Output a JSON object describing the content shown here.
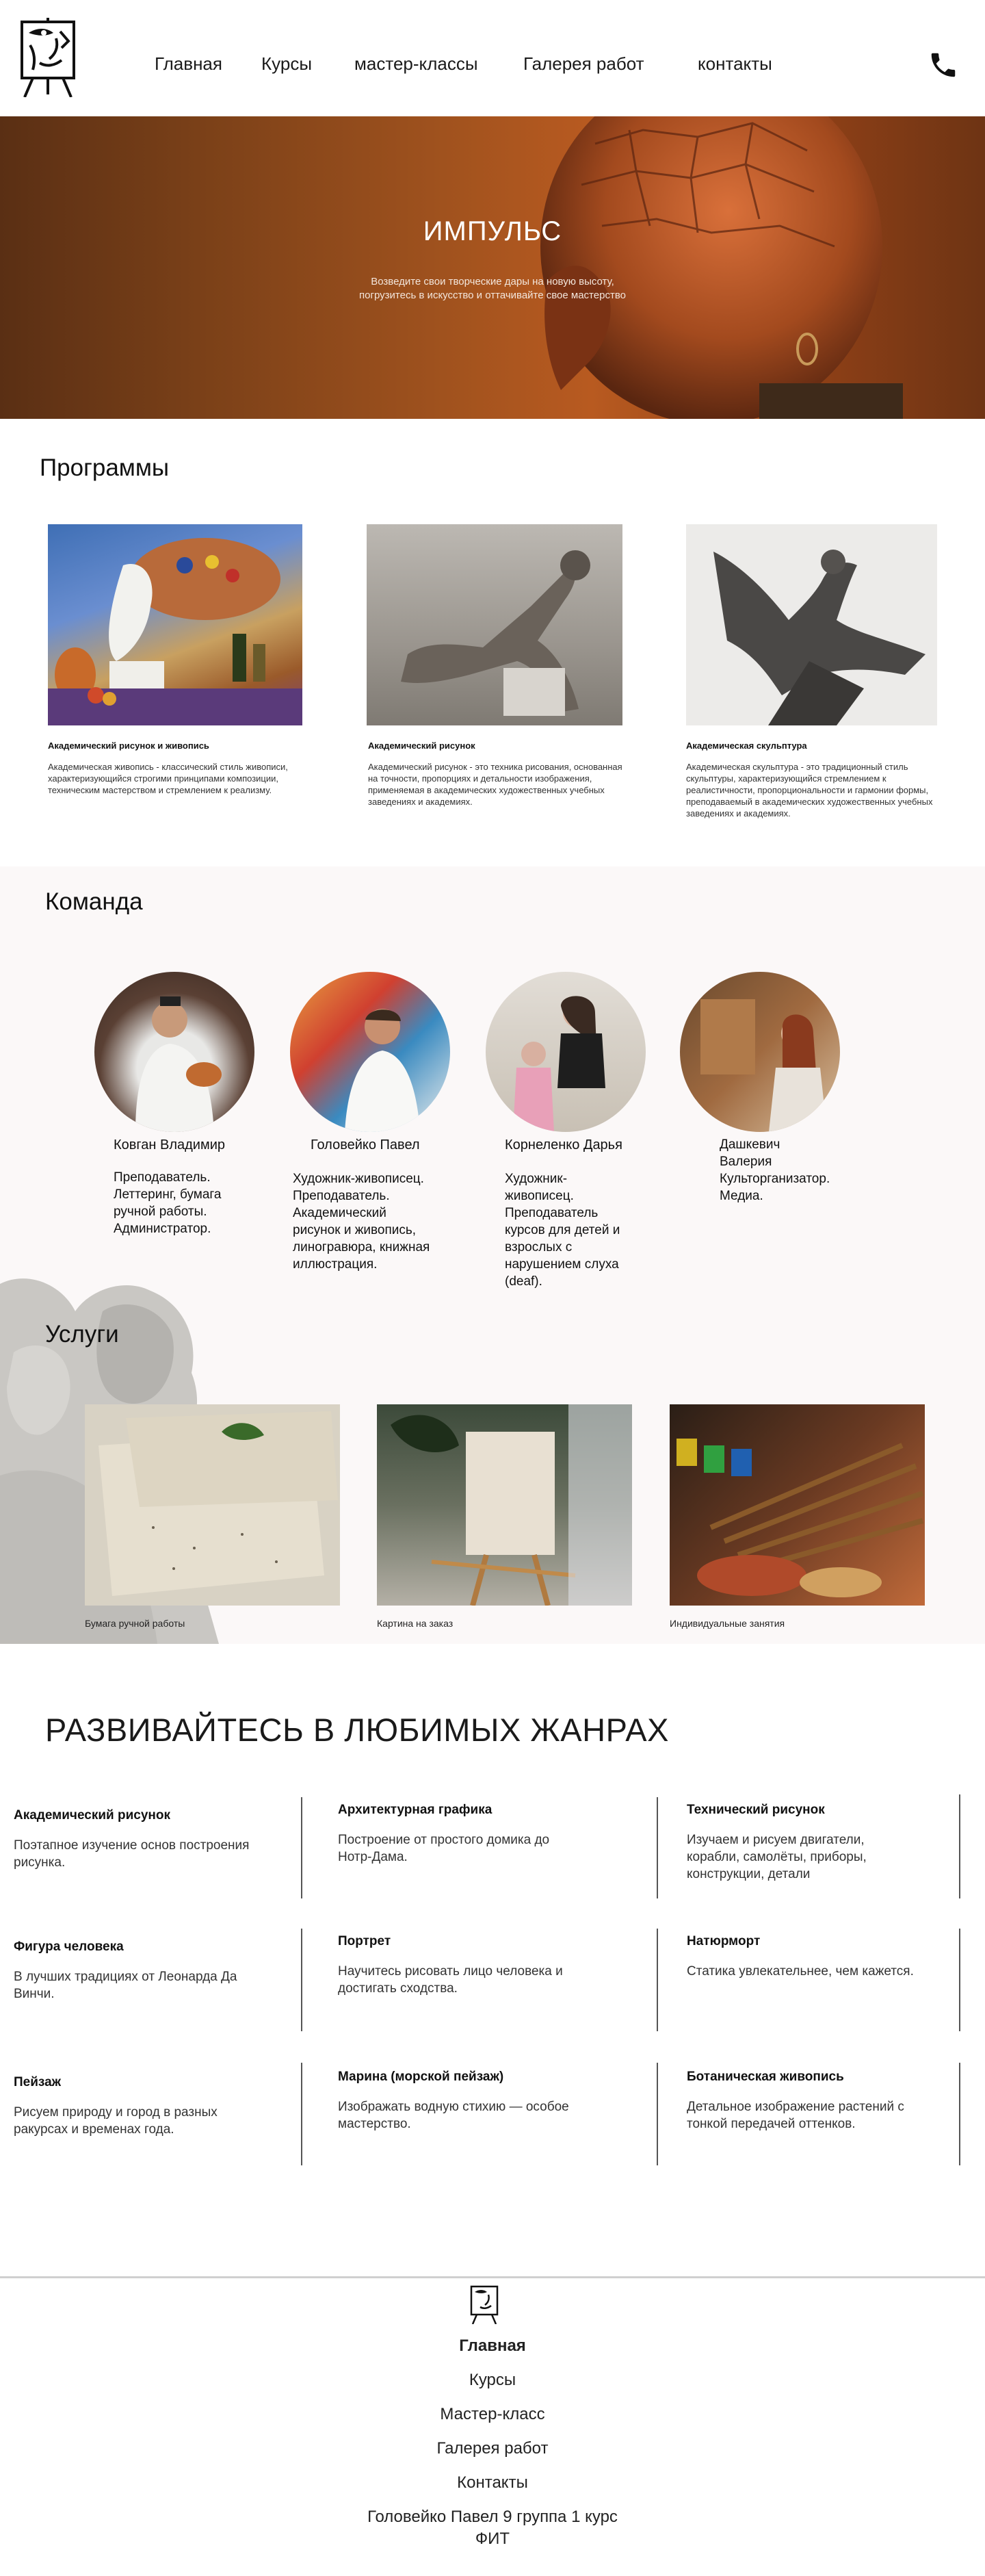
{
  "nav": {
    "items": [
      "Главная",
      "Курсы",
      "мастер-классы",
      "Галерея работ",
      "контакты"
    ]
  },
  "icons": {
    "logo": "easel-face-logo-icon",
    "phone": "phone-icon"
  },
  "hero": {
    "title": "ИМПУЛЬС",
    "subtitle_line1": "Возведите свои творческие дары на новую высоту,",
    "subtitle_line2": "погрузитесь в искусство и оттачивайте свое мастерство"
  },
  "programs": {
    "title": "Программы",
    "items": [
      {
        "name": "Академический рисунок и живопись",
        "desc": "Академическая живопись - классический стиль живописи, характеризующийся строгими принципами композиции, техническим мастерством и стремлением к реализму."
      },
      {
        "name": "Академический рисунок",
        "desc": "Академический рисунок - это техника рисования, основанная на точности, пропорциях и детальности изображения, применяемая в академических художественных учебных заведениях и академиях."
      },
      {
        "name": "Академическая скульптура",
        "desc": "Академическая скульптура - это традиционный стиль скульптуры, характеризующийся стремлением к реалистичности, пропорциональности и гармонии формы, преподаваемый в академических художественных учебных заведениях и академиях."
      }
    ]
  },
  "team": {
    "title": "Команда",
    "members": [
      {
        "name": "Ковган Владимир",
        "role_lines": [
          "Преподаватель.",
          "Леттеринг, бумага",
          "ручной работы.",
          "Администратор."
        ]
      },
      {
        "name": "Головейко Павел",
        "role_lines": [
          "Художник-живописец.",
          "Преподаватель.",
          "Академический",
          "рисунок и живопись,",
          "линогравюра, книжная",
          "иллюстрация."
        ]
      },
      {
        "name": "Корнеленко Дарья",
        "role_lines": [
          "Художник-",
          "живописец.",
          "Преподаватель",
          "курсов для детей и",
          "взрослых с",
          "нарушением слуха",
          "(deaf)."
        ]
      },
      {
        "name": "",
        "role_lines": [
          "Дашкевич",
          "Валерия",
          "Культорганизатор.",
          "Медиа."
        ]
      }
    ]
  },
  "services": {
    "title": "Услуги",
    "items": [
      "Бумага ручной работы",
      "Картина на заказ",
      "Индивидуальные занятия"
    ]
  },
  "genres": {
    "title": "РАЗВИВАЙТЕСЬ В ЛЮБИМЫХ ЖАНРАХ",
    "items": [
      {
        "name": "Академический рисунок",
        "desc_lines": [
          "Поэтапное изучение основ построения",
          "рисунка."
        ]
      },
      {
        "name": "Архитектурная графика",
        "desc_lines": [
          "Построение от простого домика до",
          "Нотр-Дама."
        ]
      },
      {
        "name": "Технический рисунок",
        "desc_lines": [
          "Изучаем и рисуем двигатели,",
          "корабли, самолёты, приборы,",
          "конструкции, детали"
        ]
      },
      {
        "name": "Фигура человека",
        "desc_lines": [
          "В лучших традициях от Леонарда Да",
          "Винчи."
        ]
      },
      {
        "name": "Портрет",
        "desc_lines": [
          "Научитесь рисовать лицо человека и",
          "достигать сходства."
        ]
      },
      {
        "name": "Натюрморт",
        "desc_lines": [
          "Статика увлекательнее, чем кажется."
        ]
      },
      {
        "name": "Пейзаж",
        "desc_lines": [
          "Рисуем природу и город в разных",
          "ракурсах и временах года."
        ]
      },
      {
        "name": "Марина (морской пейзаж)",
        "desc_lines": [
          "Изображать водную стихию — особое",
          "мастерство."
        ]
      },
      {
        "name": "Ботаническая живопись",
        "desc_lines": [
          "Детальное изображение растений с",
          "тонкой передачей оттенков."
        ]
      }
    ]
  },
  "footer": {
    "links": [
      "Главная",
      "Курсы",
      "Мастер-класс",
      "Галерея работ",
      "Контакты"
    ],
    "credit_line1": "Головейко Павел 9 группа 1 курс",
    "credit_line2": "ФИТ"
  }
}
